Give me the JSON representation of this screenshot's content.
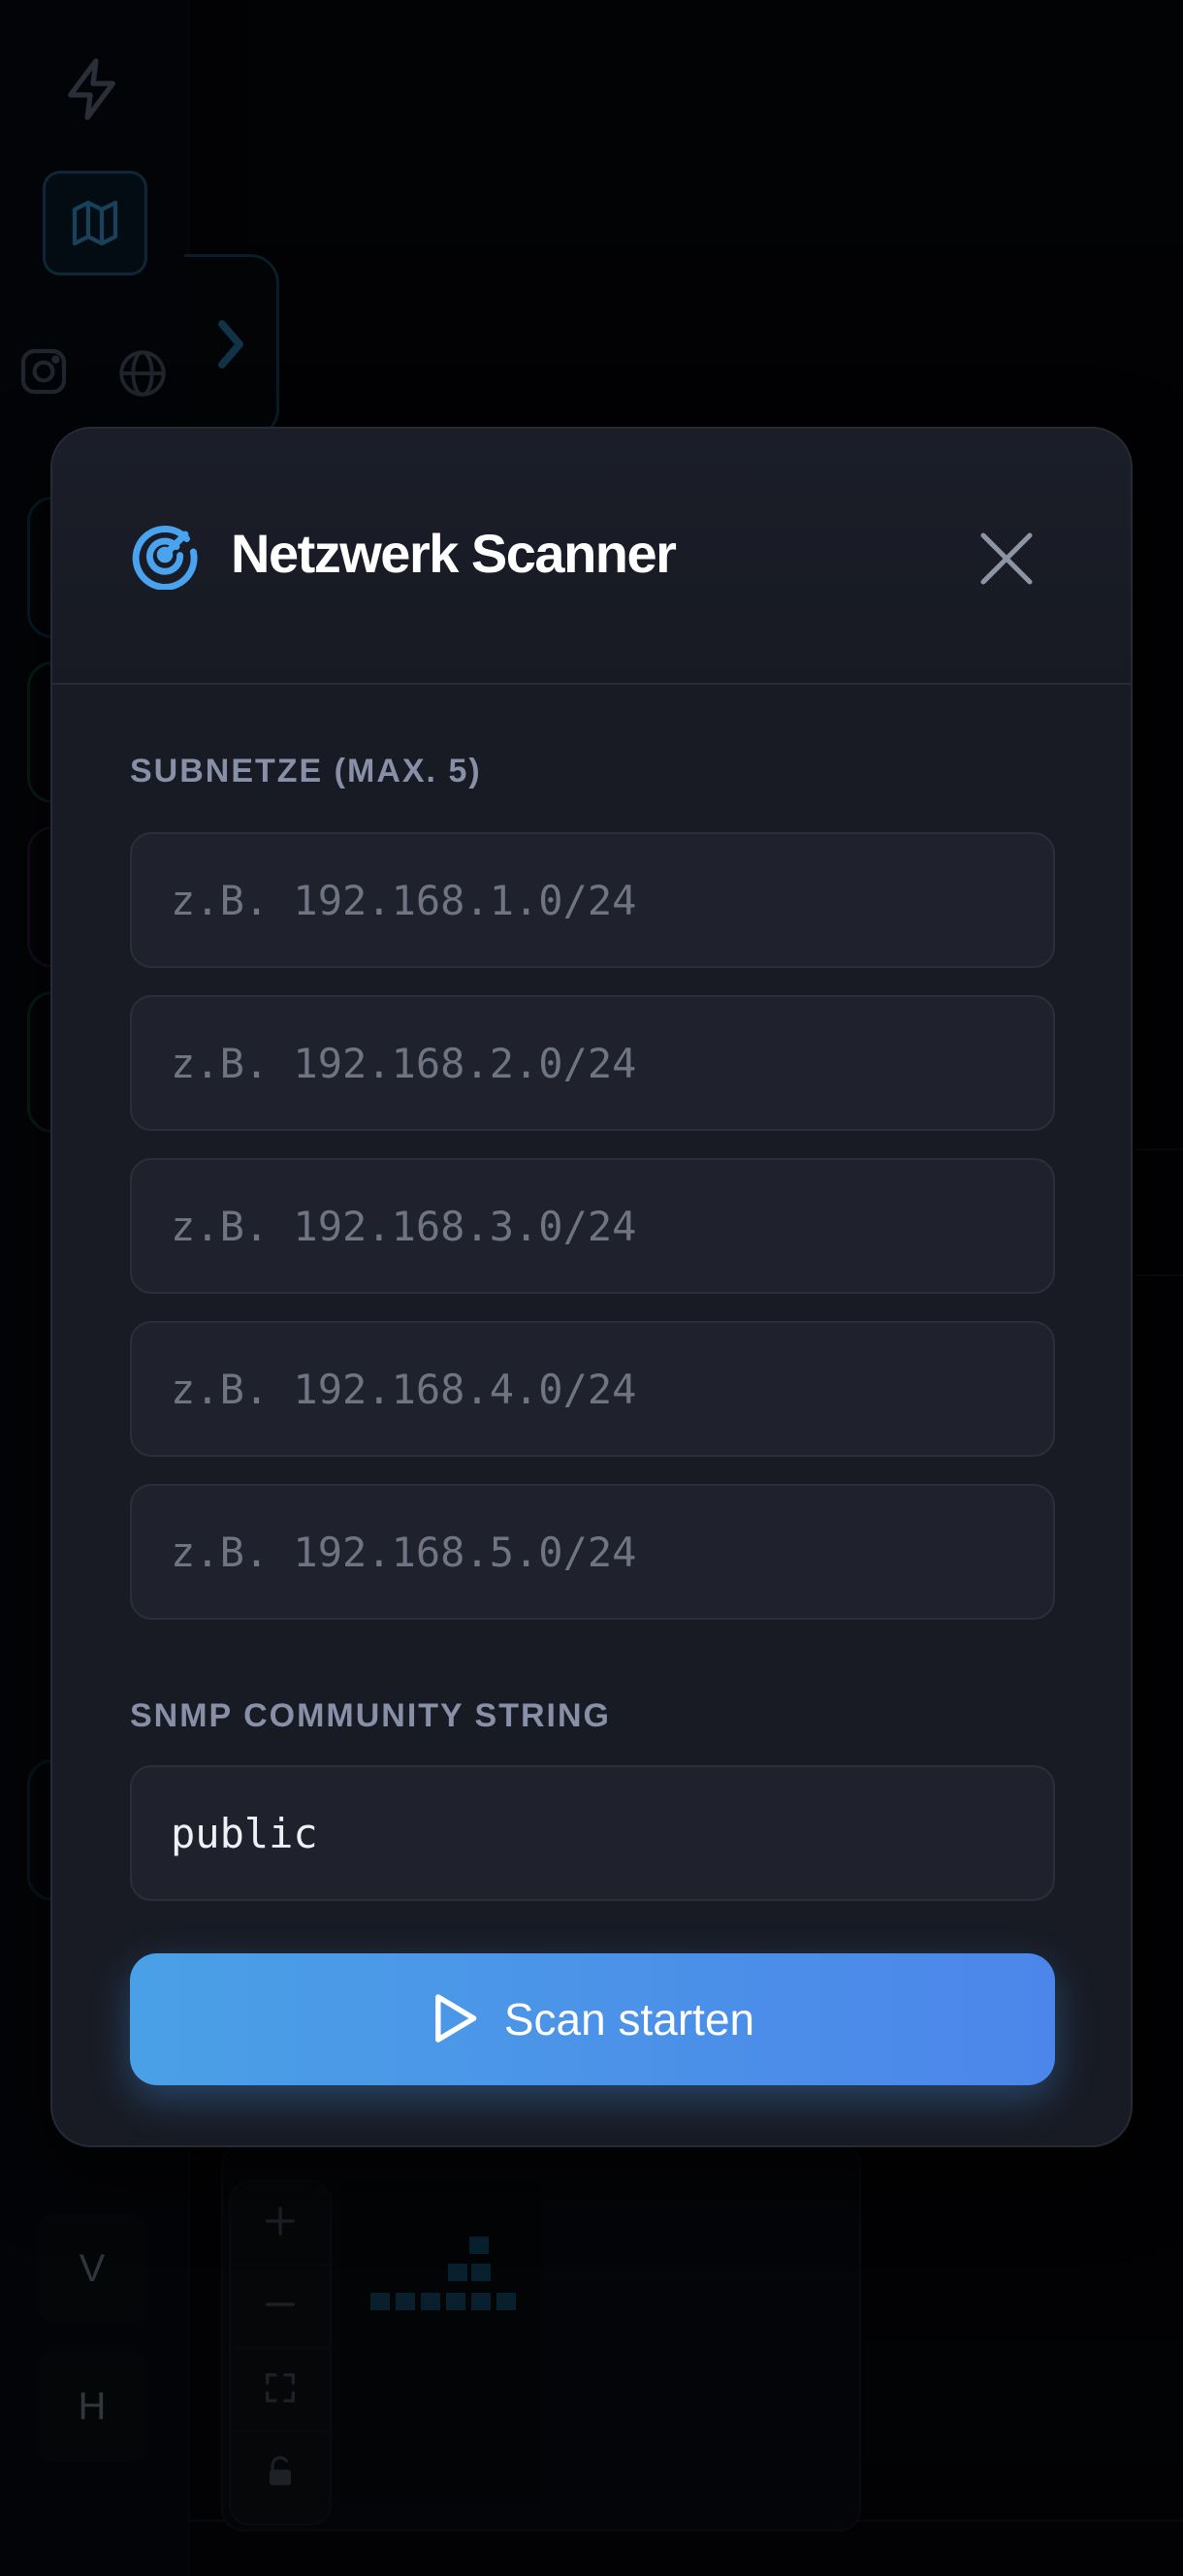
{
  "rail": {
    "letter_v": "V",
    "letter_h": "H"
  },
  "modal": {
    "title": "Netzwerk Scanner",
    "subnets_label": "SUBNETZE (MAX. 5)",
    "subnets": [
      {
        "value": "",
        "placeholder": "z.B. 192.168.1.0/24"
      },
      {
        "value": "",
        "placeholder": "z.B. 192.168.2.0/24"
      },
      {
        "value": "",
        "placeholder": "z.B. 192.168.3.0/24"
      },
      {
        "value": "",
        "placeholder": "z.B. 192.168.4.0/24"
      },
      {
        "value": "",
        "placeholder": "z.B. 192.168.5.0/24"
      }
    ],
    "snmp_label": "SNMP COMMUNITY STRING",
    "snmp_value": "public",
    "scan_button_label": "Scan starten"
  },
  "icons": {
    "header": "radar-icon",
    "close": "close-icon",
    "scan": "play-icon"
  },
  "colors": {
    "accent": "#4a9be6",
    "modal_bg": "#181b24",
    "field_bg": "#1f222d",
    "label": "#8790a6"
  }
}
